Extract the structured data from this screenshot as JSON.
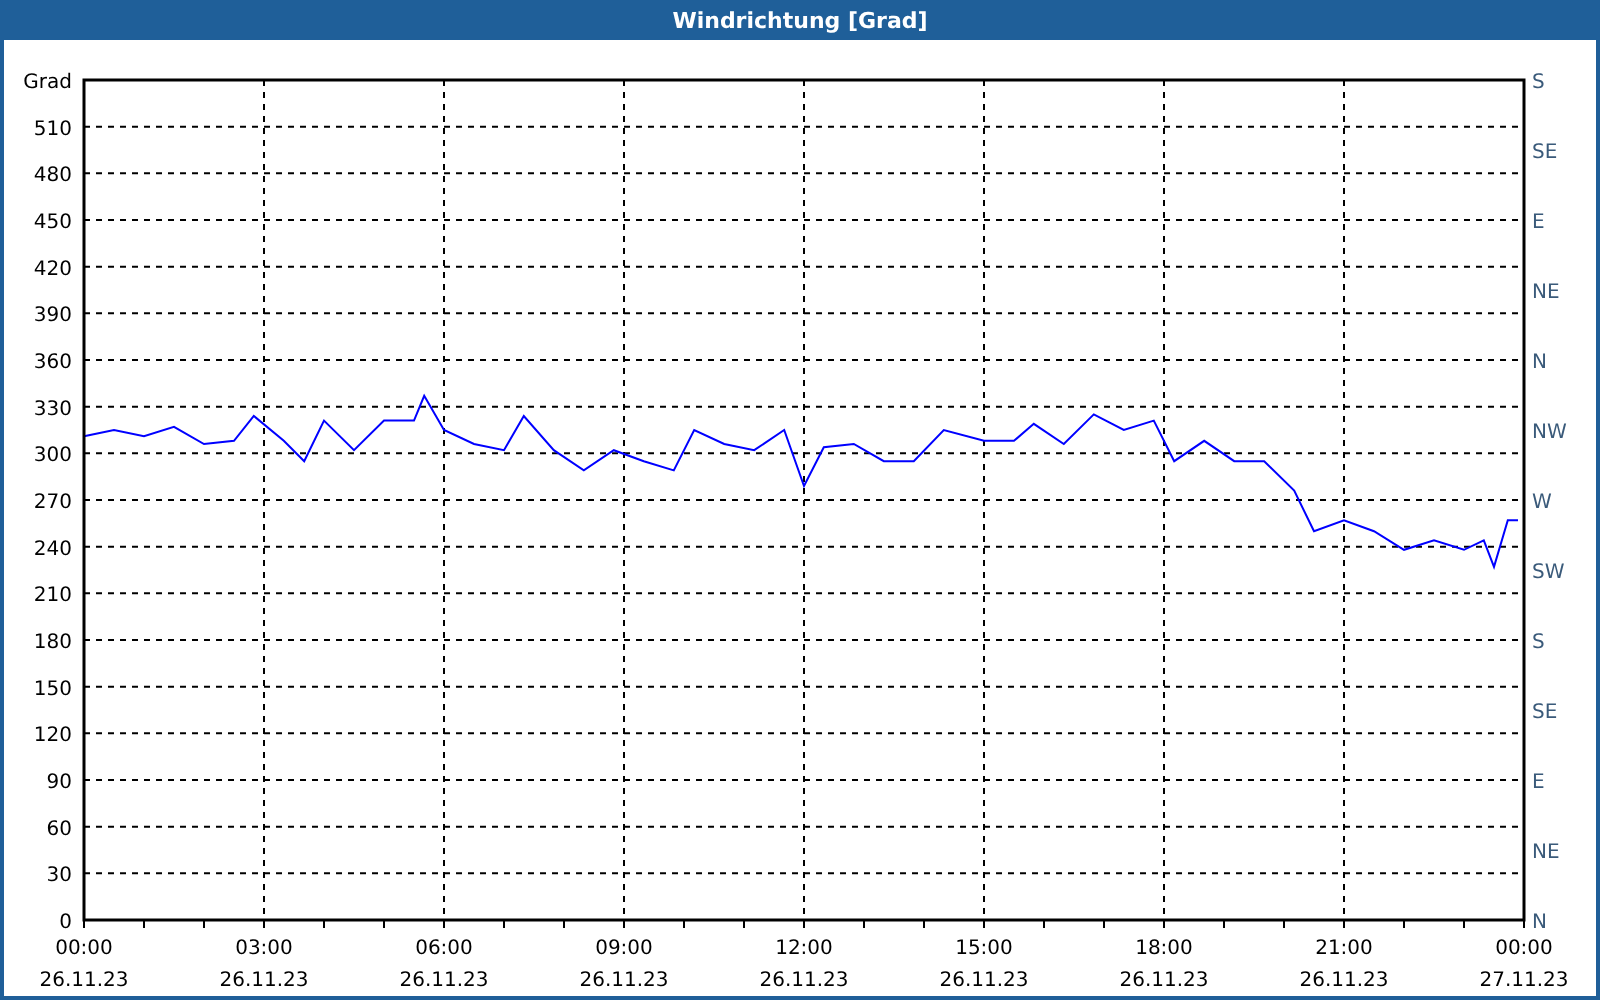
{
  "window": {
    "title": "Windrichtung [Grad]"
  },
  "chart": {
    "compass_labels": [
      "S",
      "SE",
      "E",
      "NE",
      "N",
      "NW",
      "W",
      "SW",
      "S",
      "SE",
      "E",
      "NE",
      "N"
    ],
    "date_labels": [
      "26.11.23",
      "26.11.23",
      "26.11.23",
      "26.11.23",
      "26.11.23",
      "26.11.23",
      "26.11.23",
      "26.11.23",
      "27.11.23"
    ],
    "chart_data": {
      "type": "line",
      "ylabel": "Grad",
      "grid": true,
      "x": [
        0,
        0.5,
        1,
        1.5,
        2,
        2.5,
        2.83,
        3.33,
        3.67,
        4,
        4.5,
        5,
        5.5,
        5.67,
        6,
        6.5,
        7,
        7.33,
        7.83,
        8.33,
        8.83,
        9.33,
        9.83,
        10.17,
        10.67,
        11.17,
        11.67,
        12,
        12.33,
        12.83,
        13.33,
        13.83,
        14.33,
        15,
        15.5,
        15.83,
        16.33,
        16.83,
        17.33,
        17.83,
        18.17,
        18.67,
        19.17,
        19.67,
        20.17,
        20.5,
        21,
        21.5,
        22,
        22.5,
        23,
        23.33,
        23.5,
        23.73,
        23.9
      ],
      "series": [
        {
          "color": "#0000ff",
          "values": [
            311,
            315,
            311,
            317,
            306,
            308,
            324,
            308,
            295,
            321,
            302,
            321,
            321,
            337,
            315,
            306,
            302,
            324,
            302,
            289,
            302,
            295,
            289,
            315,
            306,
            302,
            315,
            279,
            304,
            306,
            295,
            295,
            315,
            308,
            308,
            319,
            306,
            325,
            315,
            321,
            295,
            308,
            295,
            295,
            276,
            250,
            257,
            250,
            238,
            244,
            238,
            244,
            227,
            257,
            257
          ]
        }
      ],
      "xlim": [
        0,
        24
      ],
      "ylim": [
        0,
        540
      ],
      "xticks": [
        {
          "value": 0,
          "label": "00:00"
        },
        {
          "value": 3,
          "label": "03:00"
        },
        {
          "value": 6,
          "label": "06:00"
        },
        {
          "value": 9,
          "label": "09:00"
        },
        {
          "value": 12,
          "label": "12:00"
        },
        {
          "value": 15,
          "label": "15:00"
        },
        {
          "value": 18,
          "label": "18:00"
        },
        {
          "value": 21,
          "label": "21:00"
        },
        {
          "value": 24,
          "label": "00:00"
        }
      ],
      "yticks": [
        0,
        30,
        60,
        90,
        120,
        150,
        180,
        210,
        240,
        270,
        300,
        330,
        360,
        390,
        420,
        450,
        480,
        510
      ]
    }
  }
}
